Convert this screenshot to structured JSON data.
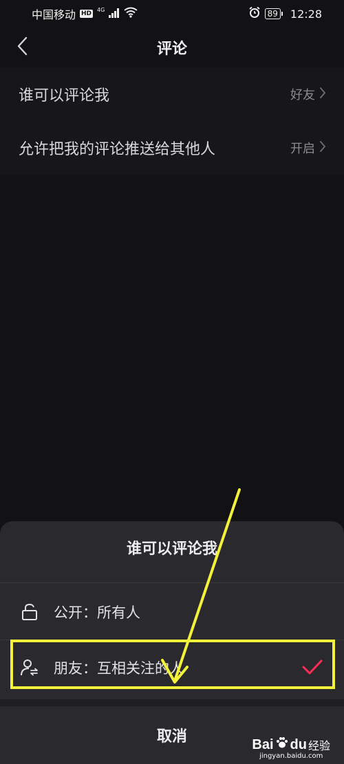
{
  "status_bar": {
    "carrier": "中国移动",
    "hd": "HD",
    "network": "4G",
    "battery": "89",
    "time": "12:28",
    "icons": [
      "signal-icon",
      "wifi-icon",
      "alarm-icon",
      "battery-icon"
    ]
  },
  "header": {
    "title": "评论",
    "back_icon": "chevron-left-icon"
  },
  "settings": [
    {
      "label": "谁可以评论我",
      "value": "好友"
    },
    {
      "label": "允许把我的评论推送给其他人",
      "value": "开启"
    }
  ],
  "sheet": {
    "title": "谁可以评论我",
    "options": [
      {
        "label": "公开：所有人",
        "icon": "unlock-icon",
        "selected": false
      },
      {
        "label": "朋友：互相关注的人",
        "icon": "mutual-follow-icon",
        "selected": true
      }
    ],
    "cancel_label": "取消"
  },
  "colors": {
    "background": "#121215",
    "sheet": "#2a2a2e",
    "check_accent": "#fe2c55",
    "highlight": "#f3f23a"
  },
  "watermark": {
    "brand_left": "Bai",
    "brand_right": "du",
    "brand_cn": "经验",
    "url": "jingyan.baidu.com"
  }
}
